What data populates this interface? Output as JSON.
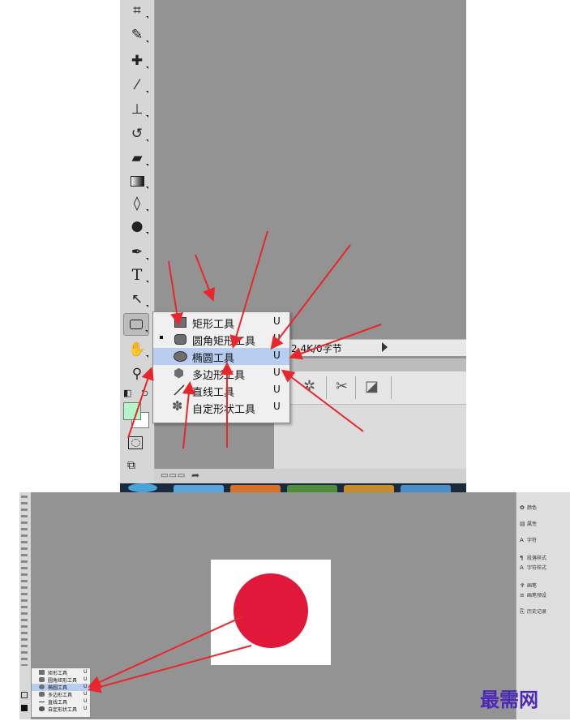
{
  "shape_menu": {
    "items": [
      {
        "label": "矩形工具",
        "key": "U",
        "icon": "rectangle-icon"
      },
      {
        "label": "圆角矩形工具",
        "key": "U",
        "icon": "rounded-rectangle-icon",
        "current": true
      },
      {
        "label": "椭圆工具",
        "key": "U",
        "icon": "ellipse-icon",
        "highlighted": true
      },
      {
        "label": "多边形工具",
        "key": "U",
        "icon": "polygon-icon"
      },
      {
        "label": "直线工具",
        "key": "U",
        "icon": "line-icon"
      },
      {
        "label": "自定形状工具",
        "key": "U",
        "icon": "custom-shape-icon"
      }
    ]
  },
  "status_bar": {
    "text": "2.4K/0字节"
  },
  "toolbar": {
    "type_tool": "T"
  },
  "right_panel": {
    "items": [
      {
        "label": "颜色",
        "icon": "color-icon"
      },
      {
        "label": "属性",
        "icon": "properties-icon"
      },
      {
        "label": "字符",
        "icon": "character-icon"
      },
      {
        "label": "段落样式",
        "icon": "paragraph-style-icon"
      },
      {
        "label": "字符样式",
        "icon": "character-style-icon"
      },
      {
        "label": "画笔",
        "icon": "brush-icon"
      },
      {
        "label": "画笔预设",
        "icon": "brush-preset-icon"
      },
      {
        "label": "历史记录",
        "icon": "history-icon"
      }
    ]
  },
  "colors": {
    "foreground": "#b3f5c6",
    "background": "#ffffff",
    "circle": "#e0193b",
    "arrows": "#e8262c",
    "highlight": "#b8cef0",
    "watermark": "#4b28b5"
  },
  "watermark": {
    "text": "最需网"
  }
}
